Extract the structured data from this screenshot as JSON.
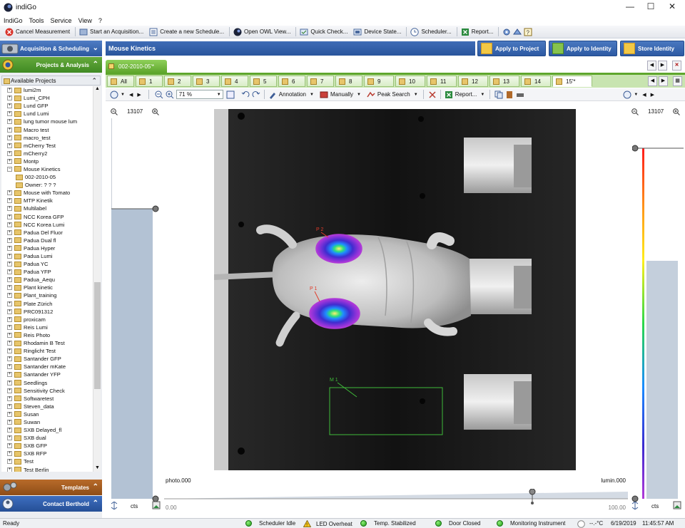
{
  "window": {
    "title": "indiGo",
    "controls": [
      "—",
      "☐",
      "✕"
    ]
  },
  "menu": [
    "IndiGo",
    "Tools",
    "Service",
    "View",
    "?"
  ],
  "toolbar": {
    "items": [
      "Cancel Measurement",
      "Start an Acquisition...",
      "Create a new Schedule...",
      "Open OWL View...",
      "Quick Check...",
      "Device State...",
      "Scheduler...",
      "Report..."
    ]
  },
  "nav": {
    "acquisition": "Acquisition & Scheduling",
    "projects": "Projects & Analysis",
    "available": "Available Projects",
    "templates": "Templates",
    "contact": "Contact Berthold"
  },
  "tree": [
    {
      "label": "lumi2m"
    },
    {
      "label": "Lumi_CPH"
    },
    {
      "label": "Lund GFP"
    },
    {
      "label": "Lund Lumi"
    },
    {
      "label": "lung tumor mouse lum"
    },
    {
      "label": "Macro test"
    },
    {
      "label": "macro_test"
    },
    {
      "label": "mCherry Test"
    },
    {
      "label": "mCherry2"
    },
    {
      "label": "Montp"
    },
    {
      "label": "Mouse Kinetics",
      "expanded": true
    },
    {
      "label": "002-2010-05",
      "child": true
    },
    {
      "label": "Owner: ? ? ?",
      "child": true
    },
    {
      "label": "Mouse with Tomato"
    },
    {
      "label": "MTP Kinetik"
    },
    {
      "label": "Multilabel"
    },
    {
      "label": "NCC Korea GFP"
    },
    {
      "label": "NCC Korea Lumi"
    },
    {
      "label": "Padua Del Fluor"
    },
    {
      "label": "Padua Dual fl"
    },
    {
      "label": "Padua Hyper"
    },
    {
      "label": "Padua Lumi"
    },
    {
      "label": "Padua YC"
    },
    {
      "label": "Padua YFP"
    },
    {
      "label": "Padua_Aequ"
    },
    {
      "label": "Plant kinetic"
    },
    {
      "label": "Plant_training"
    },
    {
      "label": "Plate Zürich"
    },
    {
      "label": "PRC091312"
    },
    {
      "label": "proxicam"
    },
    {
      "label": "Reis Lumi"
    },
    {
      "label": "Reis Photo"
    },
    {
      "label": "Rhodamin B Test"
    },
    {
      "label": "Ringlicht Test"
    },
    {
      "label": "Santander GFP"
    },
    {
      "label": "Santander mKate"
    },
    {
      "label": "Santander YFP"
    },
    {
      "label": "Seedlings"
    },
    {
      "label": "Sensitivity Check"
    },
    {
      "label": "Softwaretest"
    },
    {
      "label": "Steven_data"
    },
    {
      "label": "Susan"
    },
    {
      "label": "Suwan"
    },
    {
      "label": "SXB Delayed_fl"
    },
    {
      "label": "SXB dual"
    },
    {
      "label": "SXB GFP"
    },
    {
      "label": "SXB RFP"
    },
    {
      "label": "Test"
    },
    {
      "label": "Test Berlin"
    }
  ],
  "main": {
    "title": "Mouse Kinetics",
    "actions": [
      "Apply to Project",
      "Apply to Identity",
      "Store Identity"
    ],
    "file_tab": "002-2010-05'*",
    "image_tabs": [
      "All",
      "1",
      "2",
      "3",
      "4",
      "5",
      "6",
      "7",
      "8",
      "9",
      "10",
      "11",
      "12",
      "13",
      "14",
      "15'*"
    ],
    "image_toolbar": {
      "zoom": "71 %",
      "annotation": "Annotation",
      "manually": "Manually",
      "peak_search": "Peak Search",
      "report": "Report..."
    },
    "left_scale": {
      "value": "13107",
      "unit": "cts"
    },
    "right_scale": {
      "value": "13107",
      "unit": "cts"
    },
    "photo_label": "photo.000",
    "lumin_label": "lumin.000",
    "slider_min": "0.00",
    "slider_max": "100.00",
    "rois": [
      "P 2",
      "P 1",
      "M 1"
    ]
  },
  "status": {
    "ready": "Ready",
    "items": [
      "Scheduler Idle",
      "LED Overheat",
      "Temp. Stabilized",
      "Door Closed",
      "Monitoring Instrument"
    ],
    "temp": "--.-°C",
    "date": "6/19/2019",
    "time": "11:45:57 AM"
  }
}
